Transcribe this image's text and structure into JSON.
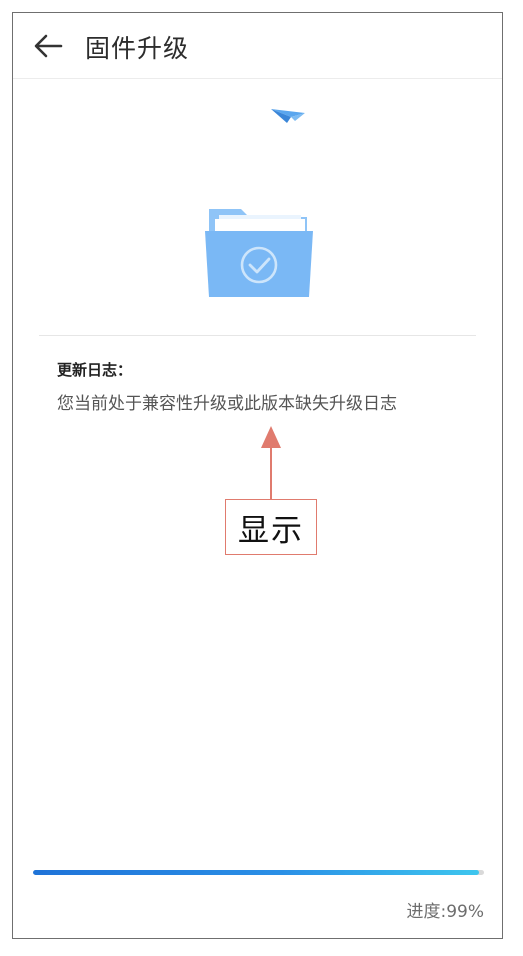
{
  "header": {
    "title": "固件升级",
    "back_icon": "arrow-left-icon"
  },
  "illustration": {
    "plane_icon": "paper-plane-icon",
    "folder_icon": "folder-check-icon",
    "colors": {
      "folder_front": "#7ab8f5",
      "folder_back": "#92c6f7",
      "paper": "#ffffff",
      "plane": "#4a98e8"
    }
  },
  "changelog": {
    "label": "更新日志：",
    "text": "您当前处于兼容性升级或此版本缺失升级日志"
  },
  "annotation": {
    "label": "显示",
    "color": "#e07b6e"
  },
  "progress": {
    "value": 99,
    "text": "进度:99%"
  }
}
